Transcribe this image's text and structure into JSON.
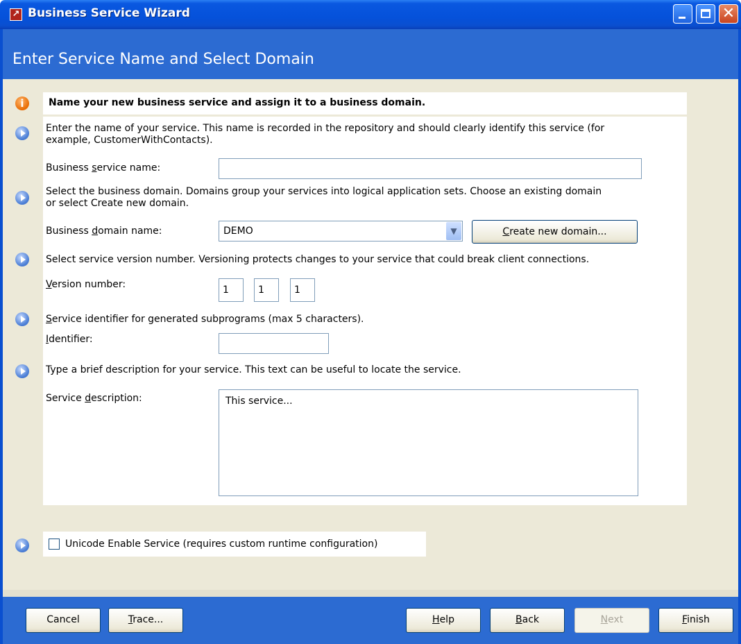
{
  "window": {
    "title": "Business Service Wizard"
  },
  "header": {
    "title": "Enter Service Name and Select Domain"
  },
  "intro": {
    "text": "Name your new business service and assign it to a business domain."
  },
  "step1": {
    "text_line1": "Enter the name of your service. This name is recorded in the repository and should clearly identify this service (for",
    "text_line2": "example, CustomerWithContacts).",
    "label_pre": "Business ",
    "label_u": "s",
    "label_post": "ervice name:",
    "value": ""
  },
  "step2": {
    "text_line1": "Select the business domain. Domains group your services into logical application sets. Choose an existing domain",
    "text_line2": "or select Create new domain.",
    "label_pre": "Business ",
    "label_u": "d",
    "label_post": "omain name:",
    "selected": "DEMO",
    "create_btn_u": "C",
    "create_btn_rest": "reate new domain..."
  },
  "step3": {
    "text": "Select service version number. Versioning protects changes to your service that could break client connections.",
    "label_u": "V",
    "label_post": "ersion number:",
    "v1": "1",
    "v2": "1",
    "v3": "1"
  },
  "step4": {
    "text_u": "S",
    "text_rest": "ervice identifier for generated subprograms (max 5 characters).",
    "label_u": "I",
    "label_post": "dentifier:",
    "value": ""
  },
  "step5": {
    "text": "Type a brief description for your service. This text can be useful to locate the service.",
    "label_pre": "Service ",
    "label_u": "d",
    "label_post": "escription:",
    "value": "This service..."
  },
  "unicode": {
    "label": "Unicode Enable Service (requires custom runtime configuration)",
    "checked": false
  },
  "buttons": {
    "cancel": "Cancel",
    "trace_u": "T",
    "trace_rest": "race...",
    "help_u": "H",
    "help_rest": "elp",
    "back_u": "B",
    "back_rest": "ack",
    "next_u": "N",
    "next_rest": "ext",
    "finish_u": "F",
    "finish_rest": "inish"
  }
}
